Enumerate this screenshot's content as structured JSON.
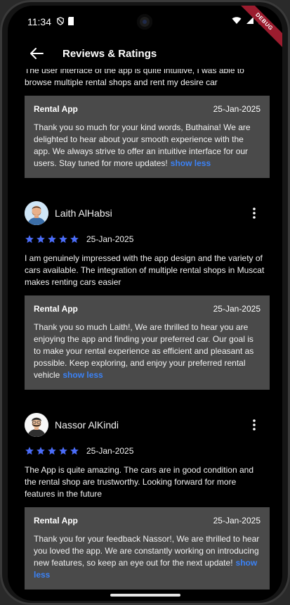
{
  "status": {
    "time": "11:34"
  },
  "debug_label": "DEBUG",
  "appbar": {
    "title": "Reviews & Ratings"
  },
  "top_review": {
    "text": "The user interface of the app is quite intuitive, I was able to browse multiple rental shops and rent my desire car",
    "reply": {
      "from": "Rental App",
      "date": "25-Jan-2025",
      "text": "Thank you so much for your kind words, Buthaina! We are delighted to hear about your smooth experience with the app. We always strive to offer an intuitive interface for our users. Stay tuned for more updates!",
      "less": "show less"
    }
  },
  "reviews": [
    {
      "name": "Laith AlHabsi",
      "rating": 5,
      "date": "25-Jan-2025",
      "text": "I am genuinely impressed with the app design and the variety of cars available. The integration of multiple rental shops in Muscat makes renting cars easier",
      "reply": {
        "from": "Rental App",
        "date": "25-Jan-2025",
        "text": "Thank you so much Laith!, We are thrilled to hear you are enjoying the app and finding your preferred car. Our goal is to make your rental experience as efficient and pleasant as possible. Keep exploring, and enjoy your preferred rental vehicle",
        "less": "show less"
      }
    },
    {
      "name": "Nassor AlKindi",
      "rating": 5,
      "date": "25-Jan-2025",
      "text": "The App is quite amazing. The cars are in good condition and the rental shop are trustworthy. Looking forward for more features in the future",
      "reply": {
        "from": "Rental App",
        "date": "25-Jan-2025",
        "text": "Thank you for your feedback Nassor!, We are thrilled to hear you loved the app.  We are constantly working on introducing new features, so keep an eye out for the next update!",
        "less": "show less"
      }
    }
  ],
  "colors": {
    "accent": "#3b82f6",
    "star": "#4a6cf7",
    "reply_bg": "#4a4a4a",
    "background": "#000000"
  }
}
